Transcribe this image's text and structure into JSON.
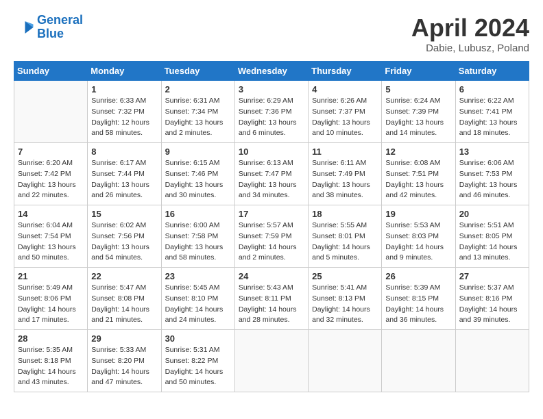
{
  "header": {
    "logo_line1": "General",
    "logo_line2": "Blue",
    "month": "April 2024",
    "location": "Dabie, Lubusz, Poland"
  },
  "weekdays": [
    "Sunday",
    "Monday",
    "Tuesday",
    "Wednesday",
    "Thursday",
    "Friday",
    "Saturday"
  ],
  "weeks": [
    [
      {
        "day": "",
        "sunrise": "",
        "sunset": "",
        "daylight": ""
      },
      {
        "day": "1",
        "sunrise": "6:33 AM",
        "sunset": "7:32 PM",
        "daylight": "12 hours and 58 minutes."
      },
      {
        "day": "2",
        "sunrise": "6:31 AM",
        "sunset": "7:34 PM",
        "daylight": "13 hours and 2 minutes."
      },
      {
        "day": "3",
        "sunrise": "6:29 AM",
        "sunset": "7:36 PM",
        "daylight": "13 hours and 6 minutes."
      },
      {
        "day": "4",
        "sunrise": "6:26 AM",
        "sunset": "7:37 PM",
        "daylight": "13 hours and 10 minutes."
      },
      {
        "day": "5",
        "sunrise": "6:24 AM",
        "sunset": "7:39 PM",
        "daylight": "13 hours and 14 minutes."
      },
      {
        "day": "6",
        "sunrise": "6:22 AM",
        "sunset": "7:41 PM",
        "daylight": "13 hours and 18 minutes."
      }
    ],
    [
      {
        "day": "7",
        "sunrise": "6:20 AM",
        "sunset": "7:42 PM",
        "daylight": "13 hours and 22 minutes."
      },
      {
        "day": "8",
        "sunrise": "6:17 AM",
        "sunset": "7:44 PM",
        "daylight": "13 hours and 26 minutes."
      },
      {
        "day": "9",
        "sunrise": "6:15 AM",
        "sunset": "7:46 PM",
        "daylight": "13 hours and 30 minutes."
      },
      {
        "day": "10",
        "sunrise": "6:13 AM",
        "sunset": "7:47 PM",
        "daylight": "13 hours and 34 minutes."
      },
      {
        "day": "11",
        "sunrise": "6:11 AM",
        "sunset": "7:49 PM",
        "daylight": "13 hours and 38 minutes."
      },
      {
        "day": "12",
        "sunrise": "6:08 AM",
        "sunset": "7:51 PM",
        "daylight": "13 hours and 42 minutes."
      },
      {
        "day": "13",
        "sunrise": "6:06 AM",
        "sunset": "7:53 PM",
        "daylight": "13 hours and 46 minutes."
      }
    ],
    [
      {
        "day": "14",
        "sunrise": "6:04 AM",
        "sunset": "7:54 PM",
        "daylight": "13 hours and 50 minutes."
      },
      {
        "day": "15",
        "sunrise": "6:02 AM",
        "sunset": "7:56 PM",
        "daylight": "13 hours and 54 minutes."
      },
      {
        "day": "16",
        "sunrise": "6:00 AM",
        "sunset": "7:58 PM",
        "daylight": "13 hours and 58 minutes."
      },
      {
        "day": "17",
        "sunrise": "5:57 AM",
        "sunset": "7:59 PM",
        "daylight": "14 hours and 2 minutes."
      },
      {
        "day": "18",
        "sunrise": "5:55 AM",
        "sunset": "8:01 PM",
        "daylight": "14 hours and 5 minutes."
      },
      {
        "day": "19",
        "sunrise": "5:53 AM",
        "sunset": "8:03 PM",
        "daylight": "14 hours and 9 minutes."
      },
      {
        "day": "20",
        "sunrise": "5:51 AM",
        "sunset": "8:05 PM",
        "daylight": "14 hours and 13 minutes."
      }
    ],
    [
      {
        "day": "21",
        "sunrise": "5:49 AM",
        "sunset": "8:06 PM",
        "daylight": "14 hours and 17 minutes."
      },
      {
        "day": "22",
        "sunrise": "5:47 AM",
        "sunset": "8:08 PM",
        "daylight": "14 hours and 21 minutes."
      },
      {
        "day": "23",
        "sunrise": "5:45 AM",
        "sunset": "8:10 PM",
        "daylight": "14 hours and 24 minutes."
      },
      {
        "day": "24",
        "sunrise": "5:43 AM",
        "sunset": "8:11 PM",
        "daylight": "14 hours and 28 minutes."
      },
      {
        "day": "25",
        "sunrise": "5:41 AM",
        "sunset": "8:13 PM",
        "daylight": "14 hours and 32 minutes."
      },
      {
        "day": "26",
        "sunrise": "5:39 AM",
        "sunset": "8:15 PM",
        "daylight": "14 hours and 36 minutes."
      },
      {
        "day": "27",
        "sunrise": "5:37 AM",
        "sunset": "8:16 PM",
        "daylight": "14 hours and 39 minutes."
      }
    ],
    [
      {
        "day": "28",
        "sunrise": "5:35 AM",
        "sunset": "8:18 PM",
        "daylight": "14 hours and 43 minutes."
      },
      {
        "day": "29",
        "sunrise": "5:33 AM",
        "sunset": "8:20 PM",
        "daylight": "14 hours and 47 minutes."
      },
      {
        "day": "30",
        "sunrise": "5:31 AM",
        "sunset": "8:22 PM",
        "daylight": "14 hours and 50 minutes."
      },
      {
        "day": "",
        "sunrise": "",
        "sunset": "",
        "daylight": ""
      },
      {
        "day": "",
        "sunrise": "",
        "sunset": "",
        "daylight": ""
      },
      {
        "day": "",
        "sunrise": "",
        "sunset": "",
        "daylight": ""
      },
      {
        "day": "",
        "sunrise": "",
        "sunset": "",
        "daylight": ""
      }
    ]
  ]
}
